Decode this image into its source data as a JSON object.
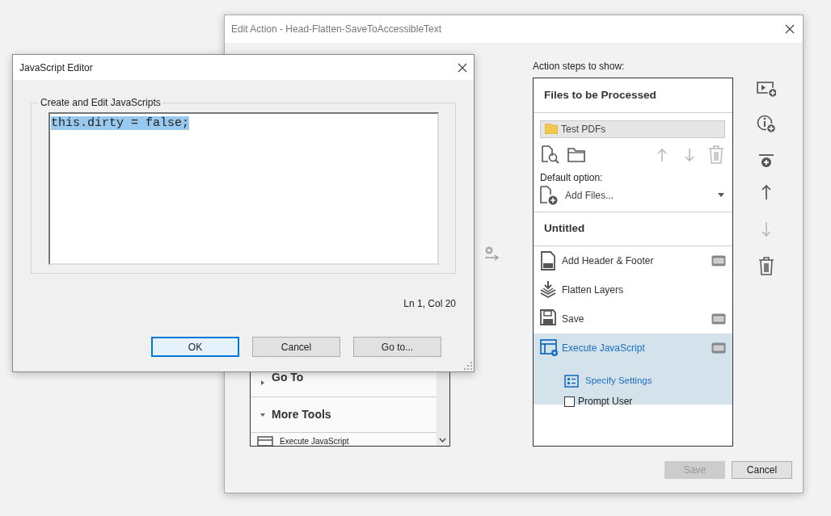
{
  "edit_action": {
    "title": "Edit Action - Head-Flatten-SaveToAccessibleText",
    "tool_groups": [
      {
        "label": "Go To",
        "expanded": false
      },
      {
        "label": "More Tools",
        "expanded": true,
        "items": [
          {
            "label": "Execute JavaScript"
          }
        ]
      }
    ],
    "steps_label": "Action steps to show:",
    "files_section": {
      "title": "Files to be Processed",
      "folder": "Test PDFs",
      "move_up_disabled": true,
      "move_down_disabled": true,
      "delete_disabled": true,
      "default_option_label": "Default option:",
      "default_option": "Add Files..."
    },
    "group_title": "Untitled",
    "steps": [
      {
        "kind": "header",
        "label": "Add Header & Footer",
        "has_dialog": true,
        "selected": false
      },
      {
        "kind": "flatten",
        "label": "Flatten Layers",
        "has_dialog": false,
        "selected": false
      },
      {
        "kind": "save",
        "label": "Save",
        "has_dialog": true,
        "selected": false
      },
      {
        "kind": "javascript",
        "label": "Execute JavaScript",
        "has_dialog": true,
        "selected": true,
        "settings_label": "Specify Settings",
        "prompt_label": "Prompt User",
        "prompt_user": false
      }
    ],
    "toolbar": [
      {
        "kind": "add-tool",
        "disabled": false
      },
      {
        "kind": "add-instruction",
        "disabled": false
      },
      {
        "kind": "add-divider",
        "disabled": false
      },
      {
        "kind": "move-up",
        "disabled": false
      },
      {
        "kind": "move-down",
        "disabled": true
      },
      {
        "kind": "delete",
        "disabled": false
      }
    ],
    "buttons": [
      {
        "label": "Save",
        "disabled": true
      },
      {
        "label": "Cancel",
        "disabled": false
      }
    ]
  },
  "js_editor": {
    "title": "JavaScript Editor",
    "group_label": "Create and Edit JavaScripts",
    "code": "this.dirty = false;",
    "code_selected": true,
    "position": "Ln 1, Col 20",
    "buttons": [
      {
        "label": "OK",
        "focused": true
      },
      {
        "label": "Cancel",
        "focused": false
      },
      {
        "label": "Go to...",
        "focused": false
      }
    ]
  }
}
